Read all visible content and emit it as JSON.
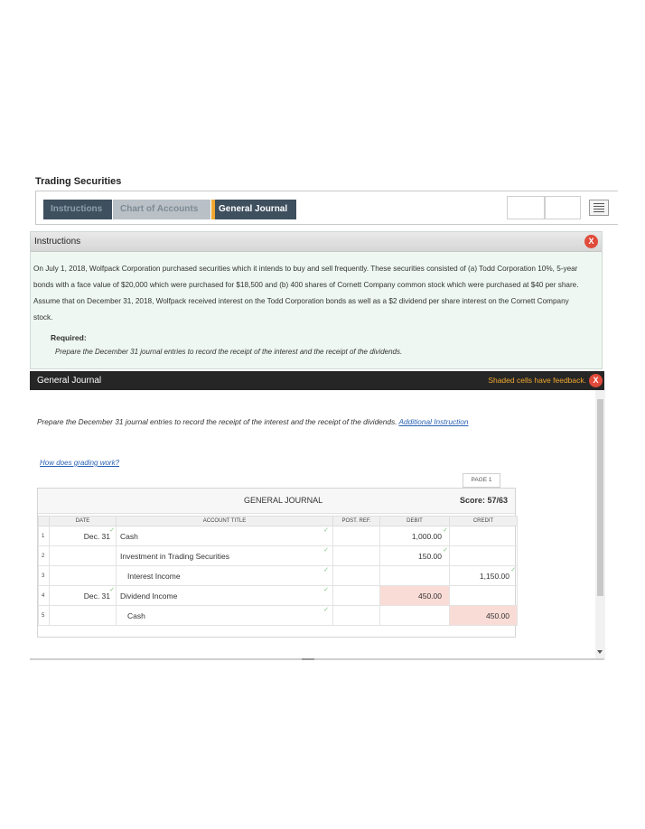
{
  "app_title": "Trading Securities",
  "tabs": [
    {
      "label": "Instructions"
    },
    {
      "label": "Chart of Accounts"
    },
    {
      "label": "General Journal"
    }
  ],
  "instructions": {
    "header": "Instructions",
    "text": "On July 1, 2018, Wolfpack Corporation purchased securities which it intends to buy and sell frequently. These securities consisted of (a) Todd Corporation 10%, 5-year bonds with a face value of $20,000 which were purchased for $18,500 and (b) 400 shares of Cornett Company common stock which were purchased at $40 per share. Assume that on December 31, 2018, Wolfpack received interest on the Todd Corporation bonds as well as a $2 dividend per share interest on the Cornett Company stock.",
    "required_label": "Required:",
    "required_text": "Prepare the December 31 journal entries to record the receipt of the interest and the receipt of the dividends."
  },
  "general_journal": {
    "header": "General Journal",
    "feedback_note": "Shaded cells have feedback.",
    "instruction": "Prepare the December 31 journal entries to record the receipt of the interest and the receipt of the dividends.",
    "additional_link": "Additional Instruction",
    "grading_link": "How does grading work?",
    "page_label": "PAGE 1",
    "journal_title": "GENERAL JOURNAL",
    "score": "Score: 57/63",
    "columns": [
      "DATE",
      "ACCOUNT TITLE",
      "POST. REF.",
      "DEBIT",
      "CREDIT"
    ],
    "rows": [
      {
        "num": "1",
        "date": "Dec. 31",
        "account": "Cash",
        "debit": "1,000.00",
        "credit": ""
      },
      {
        "num": "2",
        "date": "",
        "account": "Investment in Trading Securities",
        "debit": "150.00",
        "credit": ""
      },
      {
        "num": "3",
        "date": "",
        "account": "Interest Income",
        "debit": "",
        "credit": "1,150.00"
      },
      {
        "num": "4",
        "date": "Dec. 31",
        "account": "Dividend Income",
        "debit": "450.00",
        "credit": ""
      },
      {
        "num": "5",
        "date": "",
        "account": "Cash",
        "debit": "",
        "credit": "450.00"
      }
    ]
  },
  "colors": {
    "tab_active": "#3e4f5e",
    "tab_accent": "#f0a830",
    "instructions_bg": "#eef7f2",
    "journal_header_bg": "#262626",
    "feedback_shade": "#fadcd6",
    "close_button": "#e04a3a",
    "check_mark": "#7cc47c"
  }
}
